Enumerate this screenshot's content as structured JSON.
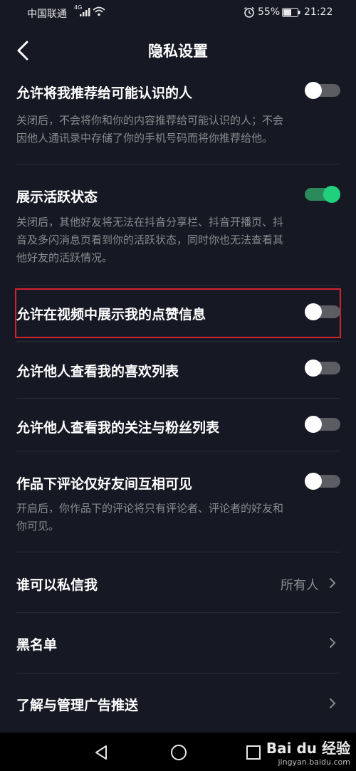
{
  "status_bar": {
    "carrier": "中国联通",
    "network": "4G",
    "battery": "55%",
    "time": "21:22"
  },
  "header": {
    "title": "隐私设置",
    "back_icon": "chevron-left-icon"
  },
  "settings": [
    {
      "title": "允许将我推荐给可能认识的人",
      "enabled": false,
      "desc_lines": [
        "关闭后，不会将你和你的内容推荐给可能认识的人；不会",
        "因他人通讯录中存储了你的手机号码而将你推荐给他。"
      ]
    },
    {
      "title": "展示活跃状态",
      "enabled": true,
      "desc_lines": [
        "关闭后，其他好友将无法在抖音分享栏、抖音开播页、抖",
        "音及多闪消息页看到你的活跃状态，同时你也无法查看其",
        "他好友的活跃情况。"
      ]
    },
    {
      "title": "允许在视频中展示我的点赞信息",
      "enabled": false
    },
    {
      "title": "允许他人查看我的喜欢列表",
      "enabled": false
    },
    {
      "title": "允许他人查看我的关注与粉丝列表",
      "enabled": false
    },
    {
      "title": "作品下评论仅好友间互相可见",
      "enabled": false,
      "desc_lines": [
        "开启后，你作品下的评论将只有评论者、评论者的好友和",
        "你可见。"
      ]
    }
  ],
  "links": [
    {
      "label": "谁可以私信我",
      "value": "所有人"
    },
    {
      "label": "黑名单",
      "value": ""
    },
    {
      "label": "了解与管理广告推送",
      "value": ""
    }
  ],
  "colors": {
    "background": "#161823",
    "toggle_on": "#20d07c",
    "highlight": "#d3232f"
  },
  "watermark": {
    "logo": "Bai du 经验",
    "url": "jingyan.baidu.com"
  }
}
